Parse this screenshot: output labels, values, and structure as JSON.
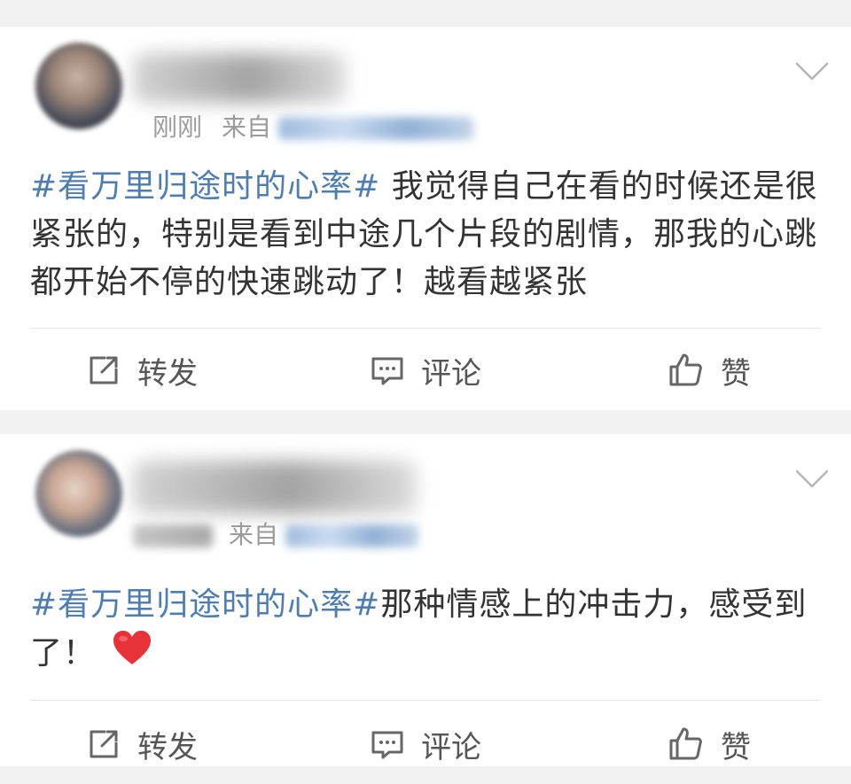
{
  "posts": [
    {
      "time": "刚刚",
      "source_label": "来自",
      "topic": "#看万里归途时的心率#",
      "text": " 我觉得自己在看的时候还是很紧张的，特别是看到中途几个片段的剧情，那我的心跳都开始不停的快速跳动了！越看越紧张",
      "actions": {
        "repost": "转发",
        "comment": "评论",
        "like": "赞"
      }
    },
    {
      "time": "",
      "source_label": "来自",
      "topic": "#看万里归途时的心率#",
      "text": "那种情感上的冲击力，感受到了！",
      "emoji": "heart-emoji",
      "actions": {
        "repost": "转发",
        "comment": "评论",
        "like": "赞"
      }
    }
  ],
  "colors": {
    "topic": "#4f7db0",
    "meta": "#9b9b9b",
    "body_text": "#333333",
    "separator_bg": "#f2f2f2",
    "heart": "#e8323a"
  }
}
